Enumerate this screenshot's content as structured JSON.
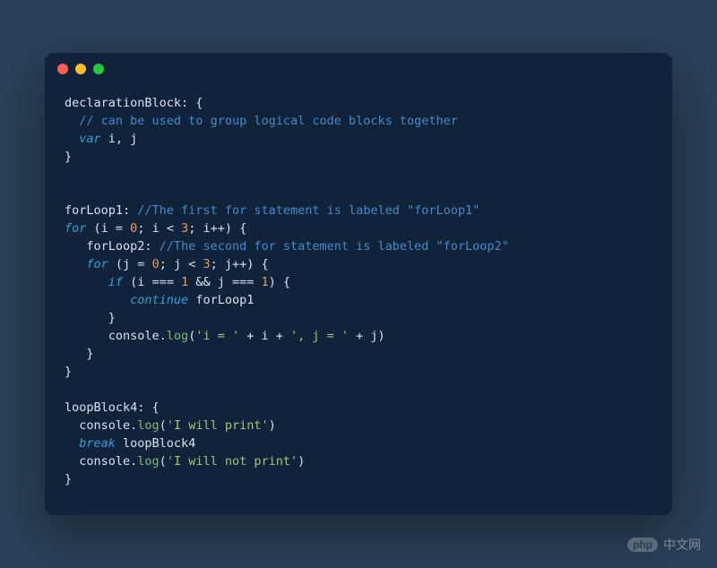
{
  "window": {
    "dots": [
      "red",
      "yellow",
      "green"
    ]
  },
  "code": {
    "l1_a": "declarationBlock: {",
    "l2_a": "  ",
    "l2_b": "// can be used to group logical code blocks together",
    "l3_a": "  ",
    "l3_b": "var",
    "l3_c": " i, j",
    "l4_a": "}",
    "l5_a": "",
    "l6_a": "",
    "l7_a": "forLoop1: ",
    "l7_b": "//The first for statement is labeled \"forLoop1\"",
    "l8_a": "for",
    "l8_b": " (i = ",
    "l8_c": "0",
    "l8_d": "; i < ",
    "l8_e": "3",
    "l8_f": "; i++) {",
    "l9_a": "   forLoop2: ",
    "l9_b": "//The second for statement is labeled \"forLoop2\"",
    "l10_a": "   ",
    "l10_b": "for",
    "l10_c": " (j = ",
    "l10_d": "0",
    "l10_e": "; j < ",
    "l10_f": "3",
    "l10_g": "; j++) {",
    "l11_a": "      ",
    "l11_b": "if",
    "l11_c": " (i === ",
    "l11_d": "1",
    "l11_e": " && j === ",
    "l11_f": "1",
    "l11_g": ") {",
    "l12_a": "         ",
    "l12_b": "continue",
    "l12_c": " forLoop1",
    "l13_a": "      }",
    "l14_a": "      console.",
    "l14_b": "log",
    "l14_c": "(",
    "l14_d": "'i = '",
    "l14_e": " + i + ",
    "l14_f": "', j = '",
    "l14_g": " + j)",
    "l15_a": "   }",
    "l16_a": "}",
    "l17_a": "",
    "l18_a": "loopBlock4: {",
    "l19_a": "  console.",
    "l19_b": "log",
    "l19_c": "(",
    "l19_d": "'I will print'",
    "l19_e": ")",
    "l20_a": "  ",
    "l20_b": "break",
    "l20_c": " loopBlock4",
    "l21_a": "  console.",
    "l21_b": "log",
    "l21_c": "(",
    "l21_d": "'I will not print'",
    "l21_e": ")",
    "l22_a": "}"
  },
  "watermark": {
    "logo": "php",
    "text": "中文网"
  }
}
